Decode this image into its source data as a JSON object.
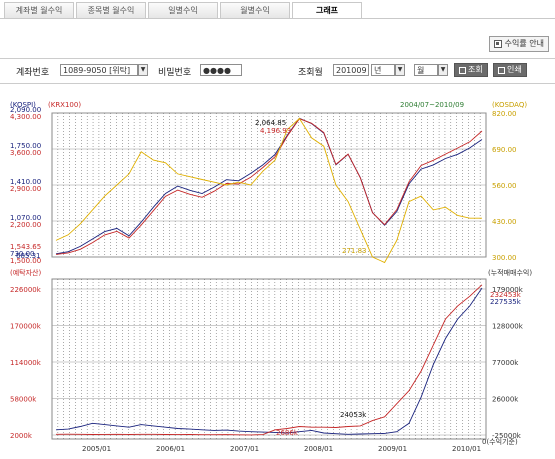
{
  "tabs": [
    {
      "label": "계좌별 월수익",
      "active": false
    },
    {
      "label": "종목별 월수익",
      "active": false
    },
    {
      "label": "일별수익",
      "active": false
    },
    {
      "label": "월별수익",
      "active": false
    },
    {
      "label": "그래프",
      "active": true
    }
  ],
  "guide_button": "수익률 안내",
  "form": {
    "account_label": "계좌번호",
    "account_value": "1089-9050 [위탁]",
    "password_label": "비밀번호",
    "password_value": "●●●●",
    "period_label": "조회월",
    "period_value": "201009",
    "period_unit": "년",
    "period_unit2": "월",
    "search_button": "조회",
    "print_button": "인쇄"
  },
  "chart_data": [
    {
      "type": "line",
      "title": "",
      "left_axis_labels": [
        "(KOSPI)",
        "(KRX100)"
      ],
      "right_axis_label": "(KOSDAQ)",
      "range_label": "2004/07~2010/09",
      "kospi_ticks": [
        "2,090.00",
        "1,750.00",
        "1,410.00",
        "1,070.00",
        "730.00"
      ],
      "krx_ticks": [
        "4,300.00",
        "3,600.00",
        "2,900.00",
        "2,200.00",
        "1,500.00"
      ],
      "kosdaq_ticks": [
        "820.00",
        "690.00",
        "560.00",
        "430.00",
        "300.00"
      ],
      "annotations": [
        "2,064.85",
        "4,196.93",
        "1,543.65",
        "685.31",
        "271.83"
      ],
      "series": [
        {
          "name": "(KOSPI)",
          "color": "#1a237e",
          "values": [
            760,
            780,
            830,
            900,
            970,
            1000,
            930,
            1060,
            1200,
            1330,
            1400,
            1360,
            1330,
            1390,
            1460,
            1450,
            1520,
            1600,
            1700,
            1880,
            2040,
            1990,
            1900,
            1600,
            1700,
            1480,
            1150,
            1030,
            1160,
            1420,
            1560,
            1600,
            1660,
            1700,
            1760,
            1840
          ]
        },
        {
          "name": "(KRX100)",
          "color": "#c62828",
          "values": [
            1550,
            1580,
            1650,
            1780,
            1930,
            2000,
            1870,
            2120,
            2400,
            2680,
            2800,
            2720,
            2660,
            2780,
            2930,
            2920,
            3050,
            3240,
            3450,
            3850,
            4190,
            4100,
            3920,
            3300,
            3500,
            3040,
            2360,
            2130,
            2420,
            2960,
            3280,
            3380,
            3500,
            3620,
            3740,
            3950
          ]
        },
        {
          "name": "(KOSDAQ)",
          "color": "#e0b000",
          "values": [
            360,
            380,
            420,
            470,
            520,
            560,
            600,
            680,
            650,
            640,
            600,
            590,
            580,
            570,
            560,
            570,
            560,
            610,
            650,
            760,
            800,
            730,
            700,
            560,
            500,
            400,
            300,
            280,
            360,
            500,
            520,
            470,
            480,
            450,
            440,
            440
          ]
        }
      ]
    },
    {
      "type": "line",
      "title": "",
      "left_axis_label": "(예탁자산)",
      "right_axis_label": "(누적매매수익)",
      "x_ticks": [
        "2005/01",
        "2006/01",
        "2007/01",
        "2008/01",
        "2009/01",
        "2010/01"
      ],
      "left_ticks": [
        "226000k",
        "170000k",
        "114000k",
        "58000k",
        "2000k"
      ],
      "right_ticks": [
        "179000k",
        "128000k",
        "77000k",
        "26000k",
        "-25000k"
      ],
      "annotations": [
        "232453k",
        "227535k",
        "24053k",
        "2686k",
        "0(수익기준)"
      ],
      "series": [
        {
          "name": "(예탁자산)",
          "color": "#1a237e",
          "values": [
            10000,
            11000,
            15000,
            20000,
            18000,
            16000,
            14000,
            18000,
            16000,
            14000,
            12000,
            11000,
            10000,
            9000,
            9500,
            8000,
            7000,
            6500,
            6000,
            5000,
            7000,
            9000,
            5000,
            4000,
            3000,
            3500,
            4000,
            4500,
            7000,
            20000,
            60000,
            110000,
            150000,
            180000,
            200000,
            227535
          ]
        },
        {
          "name": "(누적매매수익)",
          "color": "#c62828",
          "values": [
            3000,
            3200,
            3000,
            2800,
            2900,
            3000,
            2700,
            3100,
            3000,
            2800,
            2600,
            2700,
            2400,
            2500,
            2686,
            2300,
            2200,
            2600,
            10000,
            12000,
            15000,
            14000,
            14000,
            13500,
            15000,
            16000,
            24053,
            30000,
            50000,
            70000,
            100000,
            140000,
            180000,
            200000,
            215000,
            232453
          ]
        }
      ]
    }
  ]
}
